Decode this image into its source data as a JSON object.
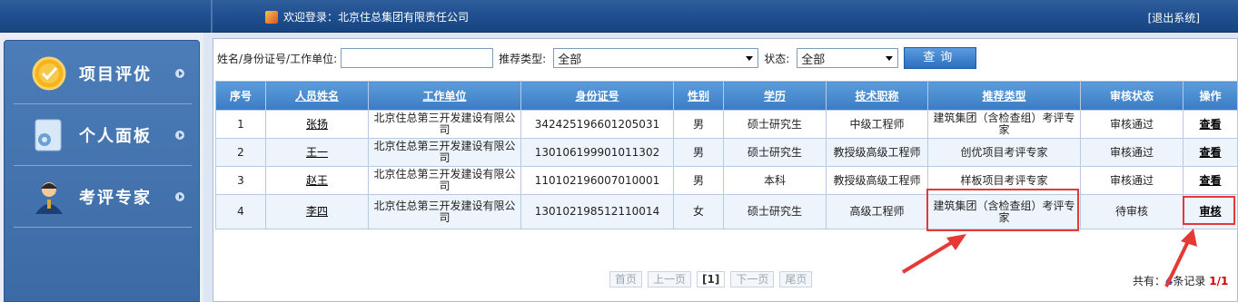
{
  "header": {
    "welcome": "欢迎登录：北京住总集团有限责任公司",
    "logout": "[退出系统]"
  },
  "sidebar": {
    "items": [
      {
        "label": "项目评优",
        "icon": "medal-icon"
      },
      {
        "label": "个人面板",
        "icon": "settings-folder-icon"
      },
      {
        "label": "考评专家",
        "icon": "expert-person-icon"
      }
    ]
  },
  "search": {
    "name_label": "姓名/身份证号/工作单位:",
    "name_value": "",
    "type_label": "推荐类型:",
    "type_value": "全部",
    "status_label": "状态:",
    "status_value": "全部",
    "query_button": "查询"
  },
  "table": {
    "headers": [
      "序号",
      "人员姓名",
      "工作单位",
      "身份证号",
      "性别",
      "学历",
      "技术职称",
      "推荐类型",
      "审核状态",
      "操作"
    ],
    "rows": [
      {
        "no": "1",
        "name": "张扬",
        "unit": "北京住总第三开发建设有限公司",
        "id": "342425196601205031",
        "gender": "男",
        "edu": "硕士研究生",
        "title": "中级工程师",
        "type": "建筑集团（含检查组）考评专家",
        "status": "审核通过",
        "op": "查看"
      },
      {
        "no": "2",
        "name": "王一",
        "unit": "北京住总第三开发建设有限公司",
        "id": "130106199901011302",
        "gender": "男",
        "edu": "硕士研究生",
        "title": "教授级高级工程师",
        "type": "创优项目考评专家",
        "status": "审核通过",
        "op": "查看"
      },
      {
        "no": "3",
        "name": "赵王",
        "unit": "北京住总第三开发建设有限公司",
        "id": "110102196007010001",
        "gender": "男",
        "edu": "本科",
        "title": "教授级高级工程师",
        "type": "样板项目考评专家",
        "status": "审核通过",
        "op": "查看"
      },
      {
        "no": "4",
        "name": "李四",
        "unit": "北京住总第三开发建设有限公司",
        "id": "130102198512110014",
        "gender": "女",
        "edu": "硕士研究生",
        "title": "高级工程师",
        "type": "建筑集团（含检查组）考评专家",
        "status": "待审核",
        "op": "审核"
      }
    ]
  },
  "pager": {
    "first": "首页",
    "prev": "上一页",
    "current": "[1]",
    "next": "下一页",
    "last": "尾页",
    "total_prefix": "共有：",
    "total_count": "4",
    "total_suffix": "条记录",
    "page_info": "1/1"
  },
  "colors": {
    "header_bar": "#1f4f8f",
    "table_header": "#3a7cc4",
    "annotation": "#e53935",
    "count_blue": "#1a3fd8",
    "page_red": "#d40000"
  }
}
